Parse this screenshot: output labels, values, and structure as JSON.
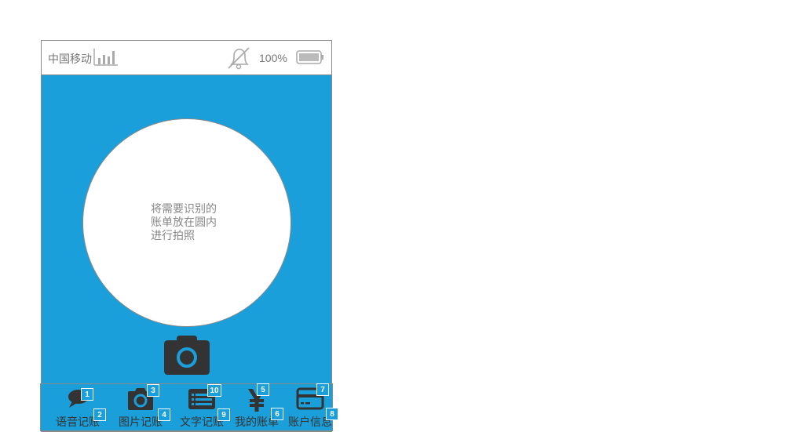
{
  "status_bar": {
    "carrier": "中国移动",
    "battery_percent": "100%",
    "icons": [
      "signal-icon",
      "mute-icon",
      "battery-icon"
    ]
  },
  "viewfinder": {
    "hint_lines": [
      "将需要识别的",
      "账单放在圆内",
      "进行拍照"
    ]
  },
  "tabs": [
    {
      "label": "语音记账",
      "icon": "speech-bubble-icon",
      "icon_badge": "1",
      "label_badge": "2"
    },
    {
      "label": "图片记账",
      "icon": "camera-icon",
      "icon_badge": "3",
      "label_badge": "4"
    },
    {
      "label": "文字记账",
      "icon": "list-icon",
      "icon_badge": "10",
      "label_badge": "9"
    },
    {
      "label": "我的账单",
      "icon": "yen-icon",
      "icon_badge": "5",
      "label_badge": "6"
    },
    {
      "label": "账户信息",
      "icon": "credit-card-icon",
      "icon_badge": "7",
      "label_badge": "8"
    }
  ],
  "colors": {
    "accent": "#1a9fda",
    "icon_dark": "#333333",
    "text_gray": "#888888"
  }
}
